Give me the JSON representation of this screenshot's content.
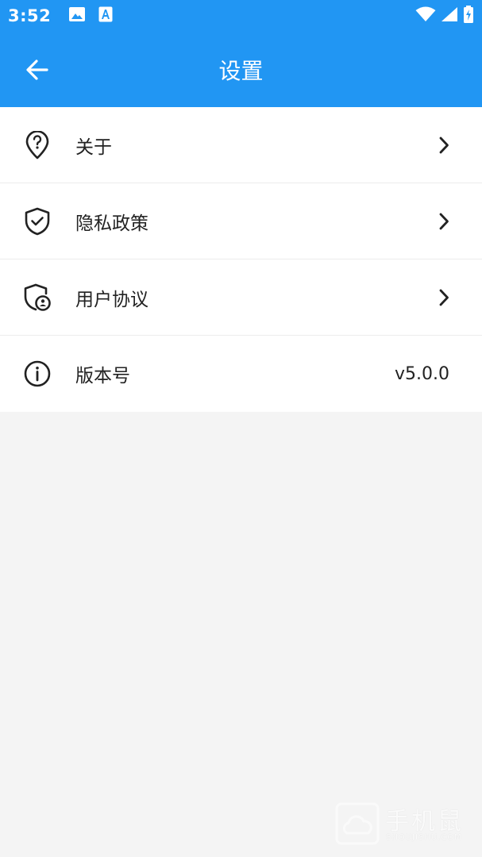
{
  "status_bar": {
    "time": "3:52",
    "left_icons": [
      "image-icon",
      "font-a-icon"
    ],
    "right_icons": [
      "wifi-icon",
      "signal-icon",
      "battery-charging-icon"
    ]
  },
  "app_bar": {
    "back_icon": "arrow-left-icon",
    "title": "设置"
  },
  "settings": {
    "items": [
      {
        "icon": "help-location-icon",
        "label": "关于",
        "trailing": "chevron-right-icon"
      },
      {
        "icon": "shield-check-icon",
        "label": "隐私政策",
        "trailing": "chevron-right-icon"
      },
      {
        "icon": "shield-user-icon",
        "label": "用户协议",
        "trailing": "chevron-right-icon"
      },
      {
        "icon": "info-icon",
        "label": "版本号",
        "value": "v5.0.0"
      }
    ]
  },
  "watermark": {
    "text": "手机鼠",
    "sub": "SHOUJISHU.COM"
  },
  "colors": {
    "primary": "#2196f3",
    "background": "#f4f4f4",
    "surface": "#ffffff",
    "text": "#222222"
  }
}
